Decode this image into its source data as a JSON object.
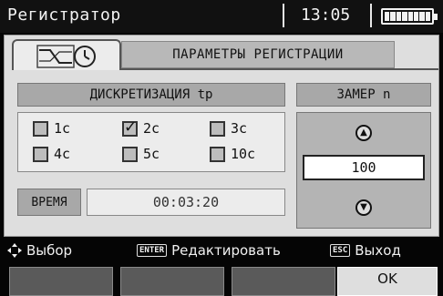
{
  "titlebar": {
    "app_title": "Регистратор",
    "time": "13:05",
    "battery_icon": "battery-full-icon"
  },
  "header": {
    "title": "ПАРАМЕТРЫ РЕГИСТРАЦИИ",
    "icons": [
      "waveform-icon",
      "clock-icon"
    ]
  },
  "sampling": {
    "label": "ДИСКРЕТИЗАЦИЯ tр",
    "options": [
      {
        "label": "1с",
        "checked": false
      },
      {
        "label": "2с",
        "checked": true
      },
      {
        "label": "3с",
        "checked": false
      },
      {
        "label": "4с",
        "checked": false
      },
      {
        "label": "5с",
        "checked": false
      },
      {
        "label": "10с",
        "checked": false
      }
    ]
  },
  "time": {
    "label": "ВРЕМЯ",
    "value": "00:03:20"
  },
  "count": {
    "label": "ЗАМЕР n",
    "value": "100",
    "up_icon": "arrow-up-icon",
    "down_icon": "arrow-down-icon"
  },
  "hints": {
    "select_label": "Выбор",
    "enter_key": "ENTER",
    "edit_label": "Редактировать",
    "esc_key": "ESC",
    "exit_label": "Выход"
  },
  "softkeys": {
    "ok_label": "OK"
  },
  "colors": {
    "panel": "#dedede",
    "background": "#050505",
    "label_gray": "#a8a8a8"
  }
}
